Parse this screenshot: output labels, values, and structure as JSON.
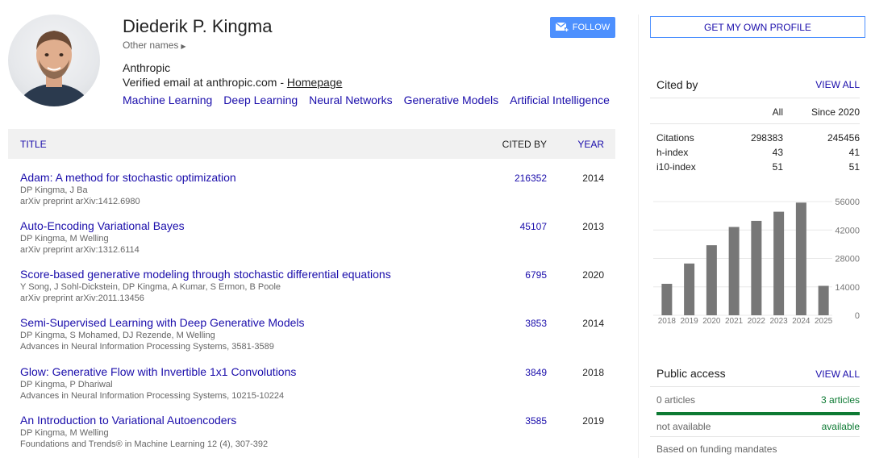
{
  "profile": {
    "name": "Diederik P. Kingma",
    "other_names": "Other names",
    "affiliation": "Anthropic",
    "verified_prefix": "Verified email at anthropic.com - ",
    "homepage_label": "Homepage",
    "interests": [
      "Machine Learning",
      "Deep Learning",
      "Neural Networks",
      "Generative Models",
      "Artificial Intelligence"
    ],
    "follow_label": "FOLLOW"
  },
  "table": {
    "headers": {
      "title": "TITLE",
      "cited_by": "CITED BY",
      "year": "YEAR"
    },
    "rows": [
      {
        "title": "Adam: A method for stochastic optimization",
        "authors": "DP Kingma, J Ba",
        "venue": "arXiv preprint arXiv:1412.6980",
        "cited_by": "216352",
        "year": "2014"
      },
      {
        "title": "Auto-Encoding Variational Bayes",
        "authors": "DP Kingma, M Welling",
        "venue": "arXiv preprint arXiv:1312.6114",
        "cited_by": "45107",
        "year": "2013"
      },
      {
        "title": "Score-based generative modeling through stochastic differential equations",
        "authors": "Y Song, J Sohl-Dickstein, DP Kingma, A Kumar, S Ermon, B Poole",
        "venue": "arXiv preprint arXiv:2011.13456",
        "cited_by": "6795",
        "year": "2020"
      },
      {
        "title": "Semi-Supervised Learning with Deep Generative Models",
        "authors": "DP Kingma, S Mohamed, DJ Rezende, M Welling",
        "venue": "Advances in Neural Information Processing Systems, 3581-3589",
        "cited_by": "3853",
        "year": "2014"
      },
      {
        "title": "Glow: Generative Flow with Invertible 1x1 Convolutions",
        "authors": "DP Kingma, P Dhariwal",
        "venue": "Advances in Neural Information Processing Systems, 10215-10224",
        "cited_by": "3849",
        "year": "2018"
      },
      {
        "title": "An Introduction to Variational Autoencoders",
        "authors": "DP Kingma, M Welling",
        "venue": "Foundations and Trends® in Machine Learning 12 (4), 307-392",
        "cited_by": "3585",
        "year": "2019"
      }
    ]
  },
  "sidebar": {
    "own_profile_label": "GET MY OWN PROFILE",
    "cited_by": {
      "heading": "Cited by",
      "view_all": "VIEW ALL",
      "col_all": "All",
      "col_since": "Since 2020",
      "metrics": [
        {
          "label": "Citations",
          "all": "298383",
          "since": "245456"
        },
        {
          "label": "h-index",
          "all": "43",
          "since": "41"
        },
        {
          "label": "i10-index",
          "all": "51",
          "since": "51"
        }
      ]
    },
    "public_access": {
      "heading": "Public access",
      "view_all": "VIEW ALL",
      "not_available_count": "0 articles",
      "available_count": "3 articles",
      "not_available_label": "not available",
      "available_label": "available",
      "footer": "Based on funding mandates"
    }
  },
  "chart_data": {
    "type": "bar",
    "categories": [
      "2018",
      "2019",
      "2020",
      "2021",
      "2022",
      "2023",
      "2024",
      "2025"
    ],
    "values": [
      15500,
      25500,
      34500,
      43500,
      46500,
      51000,
      55500,
      14500
    ],
    "yticks": [
      "56000",
      "42000",
      "28000",
      "14000",
      "0"
    ],
    "ylim": [
      0,
      56000
    ],
    "bar_color": "#777777",
    "grid": true
  },
  "colors": {
    "link": "#1a0dab",
    "accent": "#4d90fe",
    "access_green": "#0d7a33"
  }
}
